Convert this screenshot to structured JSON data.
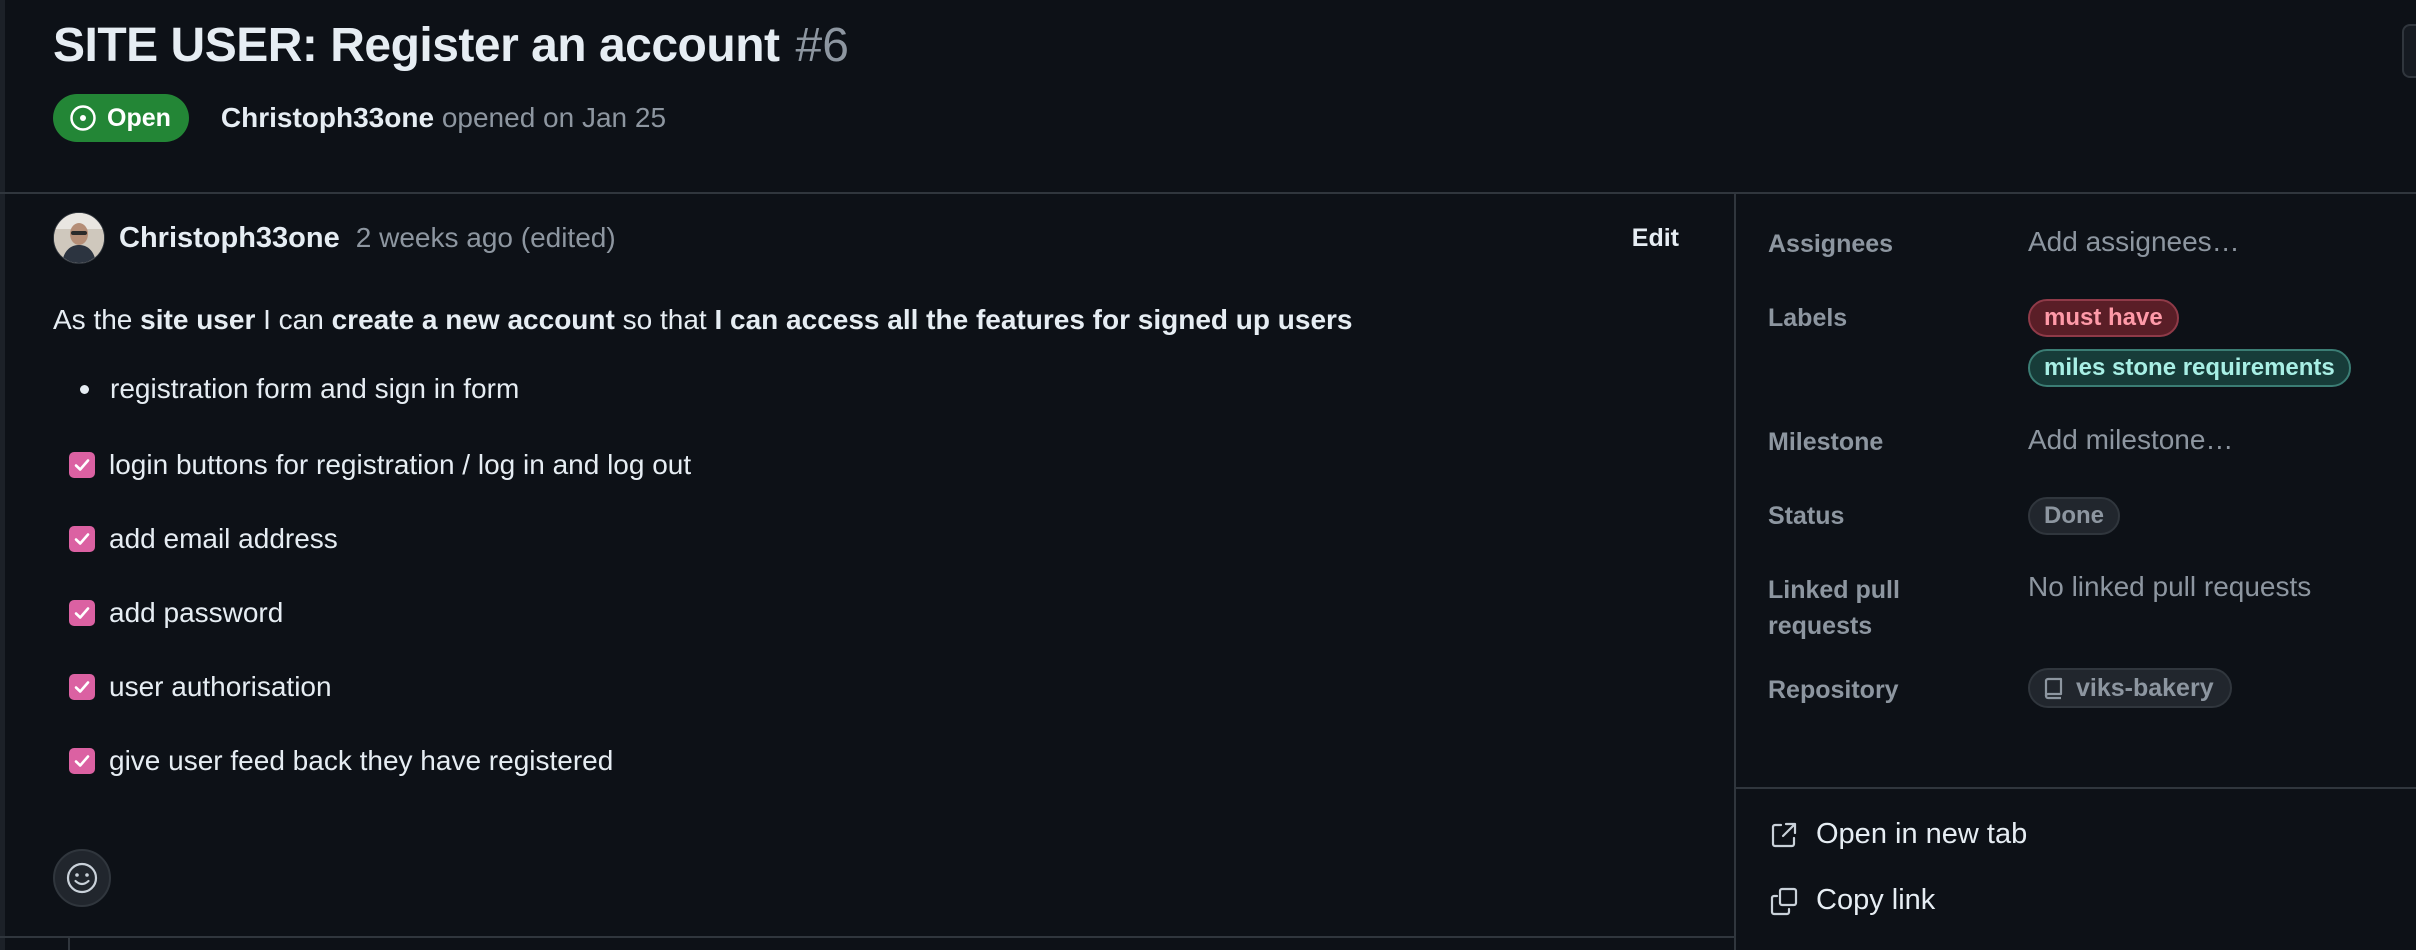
{
  "issue": {
    "title": "SITE USER: Register an account",
    "number": "#6",
    "state": "Open",
    "author": "Christoph33one",
    "opened_text": " opened on Jan 25"
  },
  "comment": {
    "author": "Christoph33one",
    "time": "2 weeks ago (edited)",
    "edit_label": "Edit",
    "story": {
      "p1": "As the ",
      "b1": "site user",
      "p2": " I can ",
      "b2": "create a new account",
      "p3": " so that ",
      "b3": "I can access all the features for signed up users"
    },
    "bullet": "registration form and sign in form",
    "tasks": [
      {
        "label": "login buttons for registration / log in and log out",
        "checked": true
      },
      {
        "label": "add email address",
        "checked": true
      },
      {
        "label": "add password",
        "checked": true
      },
      {
        "label": "user authorisation",
        "checked": true
      },
      {
        "label": "give user feed back they have registered",
        "checked": true
      }
    ]
  },
  "sidebar": {
    "assignees_label": "Assignees",
    "assignees_value": "Add assignees…",
    "labels_label": "Labels",
    "labels": [
      {
        "name": "must have",
        "color": "#ff9aa8"
      },
      {
        "name": "miles stone requirements",
        "color": "#a8efe5"
      }
    ],
    "milestone_label": "Milestone",
    "milestone_value": "Add milestone…",
    "status_label": "Status",
    "status_value": "Done",
    "linked_label_1": "Linked pull",
    "linked_label_2": "requests",
    "linked_value": "No linked pull requests",
    "repository_label": "Repository",
    "repository_value": "viks-bakery",
    "open_new_tab": "Open in new tab",
    "copy_link": "Copy link"
  },
  "colors": {
    "background": "#0d1117",
    "open_green": "#238636",
    "checkbox_pink": "#db61a2",
    "muted": "#8d96a0"
  }
}
